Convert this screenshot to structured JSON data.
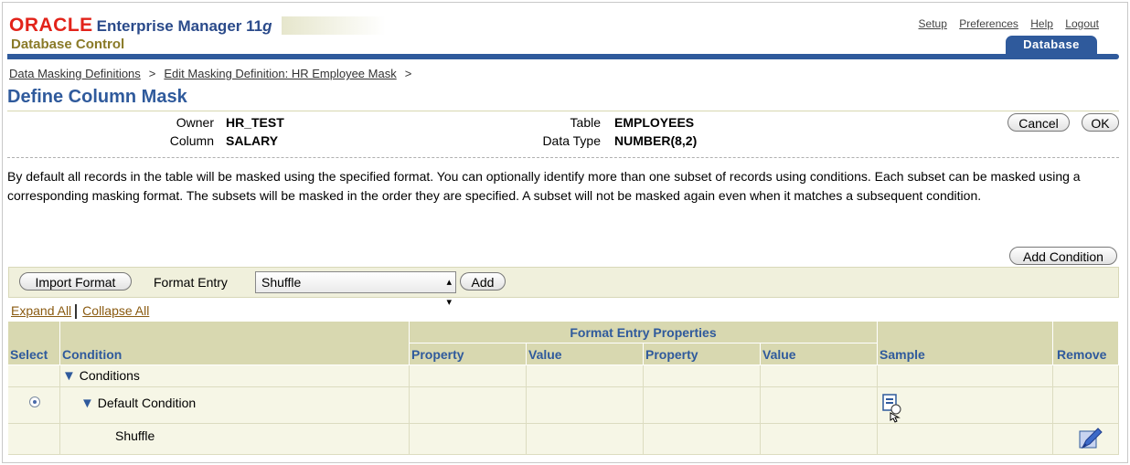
{
  "header": {
    "oracle": "ORACLE",
    "product": "Enterprise Manager 11",
    "product_version": "g",
    "subtitle": "Database Control",
    "links": [
      "Setup",
      "Preferences",
      "Help",
      "Logout"
    ],
    "tab": "Database"
  },
  "breadcrumb": {
    "items": [
      "Data Masking Definitions",
      "Edit Masking Definition: HR Employee Mask"
    ],
    "separator": ">"
  },
  "page_title": "Define Column Mask",
  "info": {
    "owner_label": "Owner",
    "owner": "HR_TEST",
    "column_label": "Column",
    "column": "SALARY",
    "table_label": "Table",
    "table": "EMPLOYEES",
    "datatype_label": "Data Type",
    "datatype": "NUMBER(8,2)"
  },
  "buttons": {
    "cancel": "Cancel",
    "ok": "OK",
    "add_condition": "Add Condition",
    "import_format": "Import Format",
    "add": "Add"
  },
  "description": "By default all records in the table will be masked using the specified format. You can optionally identify more than one subset of records using conditions. Each subset can be masked using a corresponding masking format. The subsets will be masked in the order they are specified. A subset will not be masked again even when it matches a subsequent condition.",
  "format_entry": {
    "label": "Format Entry",
    "selected": "Shuffle"
  },
  "expand_all": "Expand All",
  "collapse_all": "Collapse All",
  "table": {
    "group_header": "Format Entry Properties",
    "columns": {
      "select": "Select",
      "condition": "Condition",
      "property1": "Property",
      "value1": "Value",
      "property2": "Property",
      "value2": "Value",
      "sample": "Sample",
      "remove": "Remove"
    },
    "rows": [
      {
        "condition": "Conditions"
      },
      {
        "condition": "Default Condition"
      },
      {
        "condition": "Shuffle"
      }
    ]
  },
  "icons": {
    "expand": "triangle-down-icon",
    "sample": "sample-page-icon",
    "remove": "remove-edit-icon"
  }
}
